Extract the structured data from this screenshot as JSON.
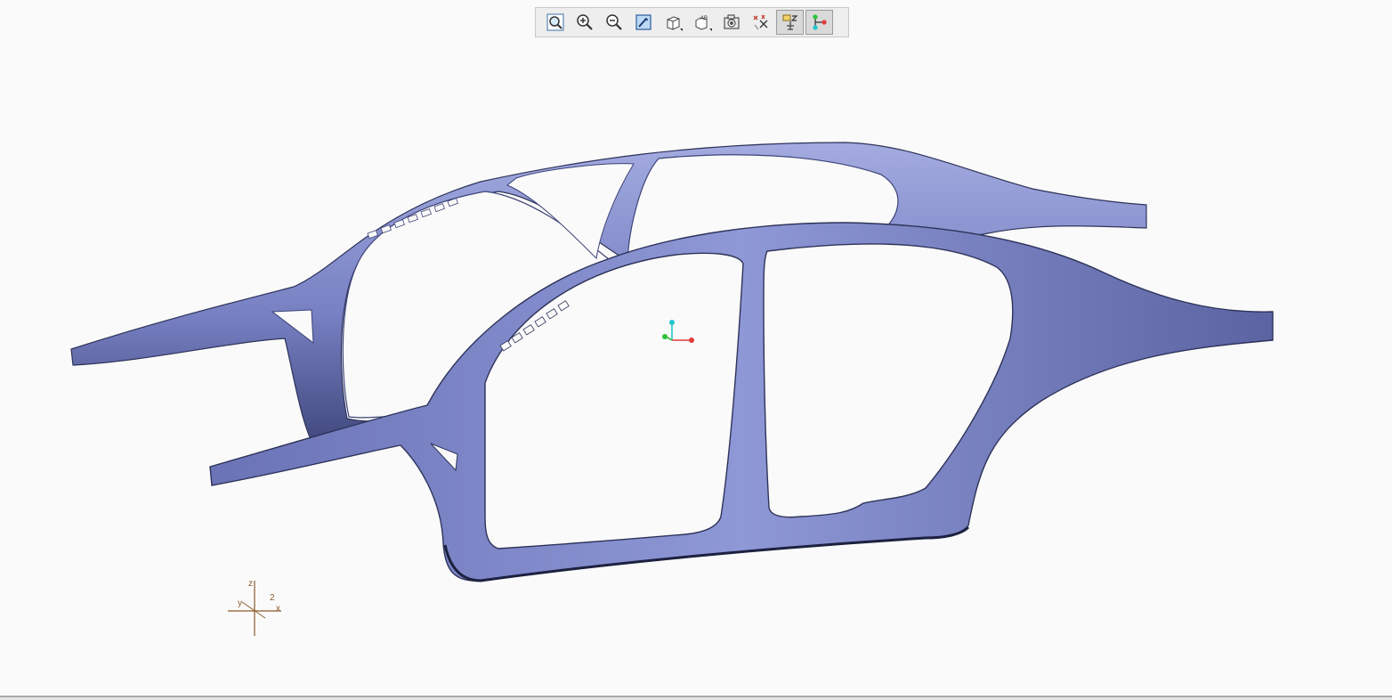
{
  "window": {
    "background": "#fafafa"
  },
  "toolbar": {
    "buttons": [
      {
        "icon": "zoom-fit-icon",
        "toggled": false
      },
      {
        "icon": "zoom-in-icon",
        "toggled": false
      },
      {
        "icon": "zoom-out-icon",
        "toggled": false
      },
      {
        "icon": "repaint-icon",
        "toggled": false
      },
      {
        "icon": "display-style-icon",
        "toggled": false,
        "flyout": true
      },
      {
        "icon": "saved-views-icon",
        "toggled": false,
        "flyout": true
      },
      {
        "icon": "view-manager-icon",
        "toggled": false
      },
      {
        "icon": "datum-display-icon",
        "toggled": false
      },
      {
        "icon": "spin-center-icon",
        "toggled": true
      },
      {
        "icon": "model-tree-icon",
        "toggled": true
      }
    ]
  },
  "model": {
    "name": "car-body-side-frame",
    "color": "#7d87c6",
    "shade": "#5c64a3",
    "dark": "#2e3359"
  },
  "triad": {
    "x_color": "#e03a3a",
    "y_color": "#2fc23a",
    "z_color": "#22c6cc"
  },
  "view_axes": {
    "z": "z",
    "y": "y",
    "x": "x",
    "extra": "2",
    "color": "#8a5a2b"
  }
}
